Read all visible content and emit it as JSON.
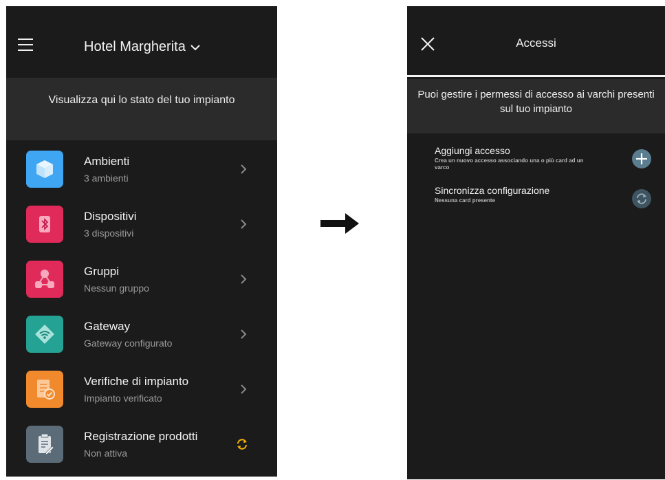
{
  "left": {
    "header": {
      "title": "Hotel Margherita"
    },
    "banner": "Visualizza qui lo stato del tuo impianto",
    "menu": [
      {
        "title": "Ambienti",
        "subtitle": "3 ambienti",
        "icon": "cube-icon",
        "color": "#3fa6f4"
      },
      {
        "title": "Dispositivi",
        "subtitle": "3 dispositivi",
        "icon": "bluetooth-icon",
        "color": "#e02a5a"
      },
      {
        "title": "Gruppi",
        "subtitle": "Nessun gruppo",
        "icon": "group-icon",
        "color": "#e02a5a"
      },
      {
        "title": "Gateway",
        "subtitle": "Gateway configurato",
        "icon": "wifi-icon",
        "color": "#24a394"
      },
      {
        "title": "Verifiche di impianto",
        "subtitle": "Impianto verificato",
        "icon": "checklist-icon",
        "color": "#f18a2c"
      },
      {
        "title": "Registrazione prodotti",
        "subtitle": "Non attiva",
        "icon": "clipboard-icon",
        "color": "#5c6b78"
      }
    ],
    "sync_color": "#f5b400"
  },
  "right": {
    "header": {
      "title": "Accessi"
    },
    "banner": "Puoi gestire i permessi di accesso ai varchi presenti sul tuo impianto",
    "actions": [
      {
        "title": "Aggiungi accesso",
        "description": "Crea un nuovo accesso associando una o più card ad un varco",
        "icon": "plus-icon"
      },
      {
        "title": "Sincronizza configurazione",
        "description": "Nessuna card presente",
        "icon": "sync-icon"
      }
    ],
    "button_color": "#5b7d90"
  }
}
